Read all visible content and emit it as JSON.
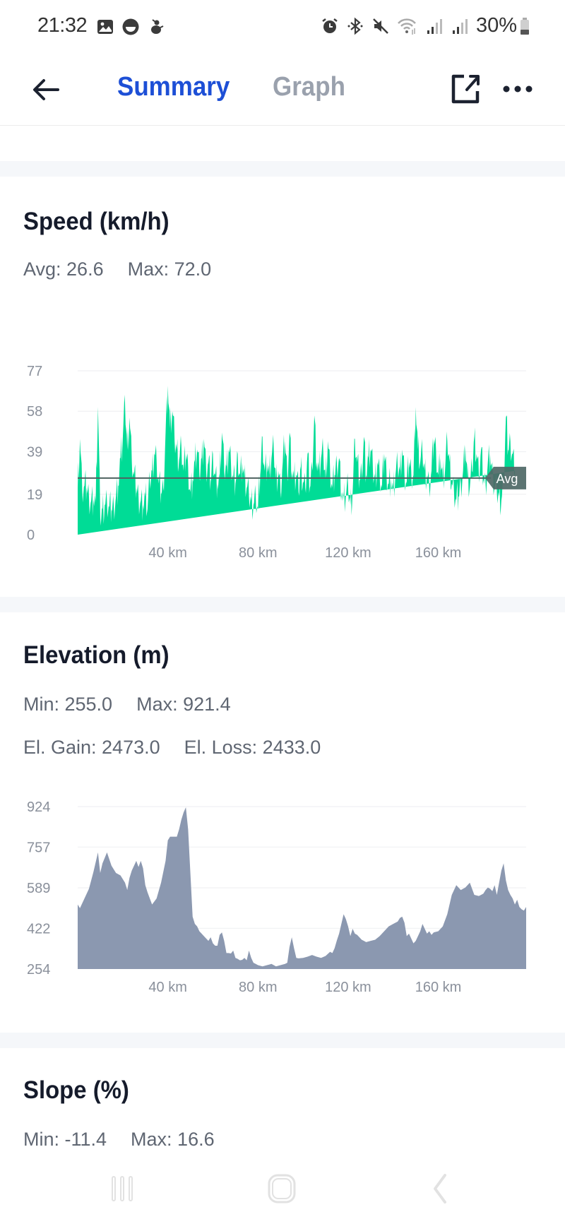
{
  "status_bar": {
    "time": "21:32",
    "left_icons": [
      "gallery-icon",
      "face-icon",
      "figure-icon"
    ],
    "right_icons": [
      "alarm-icon",
      "bluetooth-icon",
      "mute-icon",
      "wifi-icon",
      "signal-icon",
      "signal-icon"
    ],
    "battery_percent": "30%",
    "battery_level": 0.3
  },
  "header": {
    "back_icon": "arrow-left-icon",
    "tabs": [
      {
        "label": "Summary",
        "active": true
      },
      {
        "label": "Graph",
        "active": false
      }
    ],
    "share_icon": "external-link-icon",
    "more_icon": "more-horizontal-icon"
  },
  "colors": {
    "accent": "#1d4fd6",
    "tab_inactive": "#9aa1ad",
    "speed_fill": "#00dc96",
    "elevation_fill": "#8b98b0",
    "avg_line": "#4f6260",
    "avg_badge": "#4e6866"
  },
  "speed": {
    "title": "Speed (km/h)",
    "stats": [
      {
        "label": "Avg: 26.6"
      },
      {
        "label": "Max: 72.0"
      }
    ],
    "avg_badge": "Avg"
  },
  "elevation": {
    "title": "Elevation (m)",
    "stats_row1": [
      {
        "label": "Min: 255.0"
      },
      {
        "label": "Max: 921.4"
      }
    ],
    "stats_row2": [
      {
        "label": "El. Gain: 2473.0"
      },
      {
        "label": "El. Loss: 2433.0"
      }
    ]
  },
  "slope": {
    "title": "Slope (%)",
    "stats": [
      {
        "label": "Min: -11.4"
      },
      {
        "label": "Max: 16.6"
      }
    ]
  },
  "nav_bar": {
    "recent_icon": "recent-apps-icon",
    "home_icon": "home-icon",
    "back_icon": "back-icon"
  },
  "chart_data": [
    {
      "type": "area",
      "title": "Speed (km/h)",
      "xlabel": "",
      "ylabel": "",
      "x_unit": "km",
      "xlim": [
        0,
        199
      ],
      "ylim": [
        0,
        77
      ],
      "yticks": [
        0,
        19,
        39,
        58,
        77
      ],
      "ytick_labels": [
        "0",
        "19",
        "39",
        "58",
        "77"
      ],
      "xticks": [
        40,
        80,
        120,
        160
      ],
      "xtick_labels": [
        "40 km",
        "80 km",
        "120 km",
        "160 km"
      ],
      "grid": true,
      "avg_line": 26.6,
      "avg_label": "Avg",
      "series": [
        {
          "name": "Speed",
          "x": [
            0,
            1,
            2,
            3,
            4,
            5,
            6,
            7,
            8,
            9,
            10,
            11,
            12,
            13,
            14,
            15,
            16,
            17,
            18,
            19,
            20,
            21,
            22,
            23,
            24,
            25,
            26,
            27,
            28,
            29,
            30,
            31,
            32,
            33,
            34,
            35,
            36,
            37,
            38,
            39,
            40,
            41,
            42,
            43,
            44,
            45,
            46,
            47,
            48,
            49,
            50,
            51,
            52,
            53,
            54,
            55,
            56,
            57,
            58,
            59,
            60,
            61,
            62,
            63,
            64,
            65,
            66,
            67,
            68,
            69,
            70,
            71,
            72,
            73,
            74,
            75,
            76,
            77,
            78,
            79,
            80,
            81,
            82,
            83,
            84,
            85,
            86,
            87,
            88,
            89,
            90,
            91,
            92,
            93,
            94,
            95,
            96,
            97,
            98,
            99,
            100,
            101,
            102,
            103,
            104,
            105,
            106,
            107,
            108,
            109,
            110,
            111,
            112,
            113,
            114,
            115,
            116,
            117,
            118,
            119,
            120,
            121,
            122,
            123,
            124,
            125,
            126,
            127,
            128,
            129,
            130,
            131,
            132,
            133,
            134,
            135,
            136,
            137,
            138,
            139,
            140,
            141,
            142,
            143,
            144,
            145,
            146,
            147,
            148,
            149,
            150,
            151,
            152,
            153,
            154,
            155,
            156,
            157,
            158,
            159,
            160,
            161,
            162,
            163,
            164,
            165,
            166,
            167,
            168,
            169,
            170,
            171,
            172,
            173,
            174,
            175,
            176,
            177,
            178,
            179,
            180,
            181,
            182,
            183,
            184,
            185,
            186,
            187,
            188,
            189,
            190,
            191,
            192,
            193,
            194,
            195,
            196,
            197,
            198,
            199
          ],
          "values": [
            22,
            45,
            21,
            23,
            22,
            18,
            16,
            17,
            15,
            60,
            8,
            12,
            14,
            15,
            13,
            12,
            14,
            18,
            23,
            36,
            45,
            62,
            40,
            55,
            35,
            28,
            22,
            18,
            16,
            14,
            18,
            12,
            25,
            30,
            38,
            35,
            24,
            20,
            22,
            48,
            70,
            50,
            58,
            44,
            40,
            35,
            42,
            30,
            38,
            32,
            20,
            26,
            34,
            40,
            28,
            36,
            45,
            30,
            34,
            25,
            38,
            28,
            24,
            26,
            48,
            30,
            32,
            40,
            34,
            26,
            24,
            38,
            28,
            34,
            26,
            22,
            18,
            16,
            14,
            18,
            12,
            28,
            46,
            30,
            34,
            28,
            36,
            40,
            26,
            30,
            20,
            34,
            44,
            28,
            48,
            30,
            26,
            28,
            20,
            32,
            25,
            22,
            38,
            22,
            32,
            56,
            34,
            30,
            36,
            38,
            26,
            44,
            30,
            22,
            28,
            34,
            36,
            20,
            16,
            18,
            22,
            14,
            20,
            45,
            34,
            26,
            30,
            46,
            28,
            36,
            40,
            30,
            26,
            34,
            28,
            22,
            38,
            30,
            24,
            26,
            20,
            28,
            32,
            30,
            40,
            28,
            24,
            34,
            30,
            28,
            60,
            40,
            34,
            38,
            30,
            28,
            22,
            30,
            45,
            40,
            28,
            36,
            26,
            30,
            44,
            34,
            24,
            20,
            16,
            18,
            24,
            30,
            42,
            26,
            22,
            30,
            46,
            38,
            28,
            40,
            26,
            24,
            34,
            38,
            28,
            22,
            20,
            18,
            16,
            24,
            55,
            40,
            44,
            38,
            30
          ]
        }
      ]
    },
    {
      "type": "area",
      "title": "Elevation (m)",
      "xlabel": "",
      "ylabel": "",
      "x_unit": "km",
      "xlim": [
        0,
        199
      ],
      "ylim": [
        254,
        924
      ],
      "yticks": [
        254,
        422,
        589,
        757,
        924
      ],
      "ytick_labels": [
        "254",
        "422",
        "589",
        "757",
        "924"
      ],
      "xticks": [
        40,
        80,
        120,
        160
      ],
      "xtick_labels": [
        "40 km",
        "80 km",
        "120 km",
        "160 km"
      ],
      "grid": true,
      "series": [
        {
          "name": "Elevation",
          "x": [
            0,
            1,
            3,
            5,
            7,
            9,
            10,
            11,
            13,
            15,
            17,
            19,
            21,
            22,
            23,
            24,
            25,
            26,
            27,
            28,
            29,
            30,
            31,
            33,
            35,
            37,
            39,
            40,
            41,
            42,
            43,
            44,
            45,
            46,
            47,
            48,
            49,
            50,
            51,
            52,
            53,
            54,
            55,
            56,
            57,
            58,
            59,
            60,
            61,
            62,
            63,
            64,
            65,
            66,
            67,
            68,
            69,
            70,
            71,
            72,
            73,
            74,
            75,
            76,
            77,
            78,
            79,
            80,
            82,
            84,
            86,
            88,
            90,
            92,
            93,
            94,
            95,
            96,
            97,
            98,
            100,
            102,
            104,
            106,
            108,
            110,
            112,
            113,
            114,
            115,
            116,
            117,
            118,
            119,
            120,
            121,
            122,
            123,
            124,
            125,
            126,
            127,
            128,
            130,
            132,
            134,
            136,
            138,
            140,
            142,
            143,
            144,
            145,
            146,
            147,
            148,
            149,
            150,
            151,
            152,
            153,
            154,
            155,
            156,
            157,
            158,
            160,
            162,
            164,
            166,
            168,
            170,
            172,
            174,
            176,
            178,
            179,
            180,
            181,
            182,
            183,
            184,
            185,
            186,
            187,
            188,
            189,
            190,
            191,
            192,
            193,
            194,
            195,
            196,
            197,
            198,
            199
          ],
          "values": [
            520,
            505,
            545,
            585,
            655,
            735,
            650,
            690,
            735,
            680,
            650,
            640,
            610,
            580,
            630,
            660,
            680,
            700,
            675,
            700,
            670,
            600,
            570,
            520,
            545,
            610,
            700,
            785,
            800,
            800,
            800,
            800,
            830,
            870,
            900,
            921,
            830,
            650,
            470,
            440,
            430,
            410,
            400,
            390,
            380,
            370,
            385,
            360,
            350,
            350,
            395,
            405,
            370,
            320,
            320,
            318,
            330,
            300,
            296,
            290,
            292,
            300,
            290,
            330,
            300,
            280,
            275,
            270,
            265,
            270,
            275,
            265,
            270,
            275,
            280,
            345,
            385,
            340,
            300,
            298,
            300,
            305,
            312,
            305,
            300,
            308,
            325,
            320,
            340,
            372,
            400,
            440,
            480,
            460,
            430,
            390,
            420,
            400,
            395,
            385,
            375,
            370,
            365,
            370,
            375,
            390,
            410,
            430,
            440,
            450,
            465,
            470,
            445,
            390,
            400,
            380,
            360,
            370,
            390,
            410,
            440,
            420,
            400,
            410,
            395,
            405,
            410,
            430,
            480,
            560,
            600,
            580,
            590,
            610,
            560,
            555,
            560,
            565,
            580,
            590,
            585,
            575,
            600,
            560,
            610,
            660,
            690,
            620,
            580,
            560,
            545,
            520,
            540,
            510,
            500,
            495,
            510
          ]
        }
      ]
    }
  ]
}
